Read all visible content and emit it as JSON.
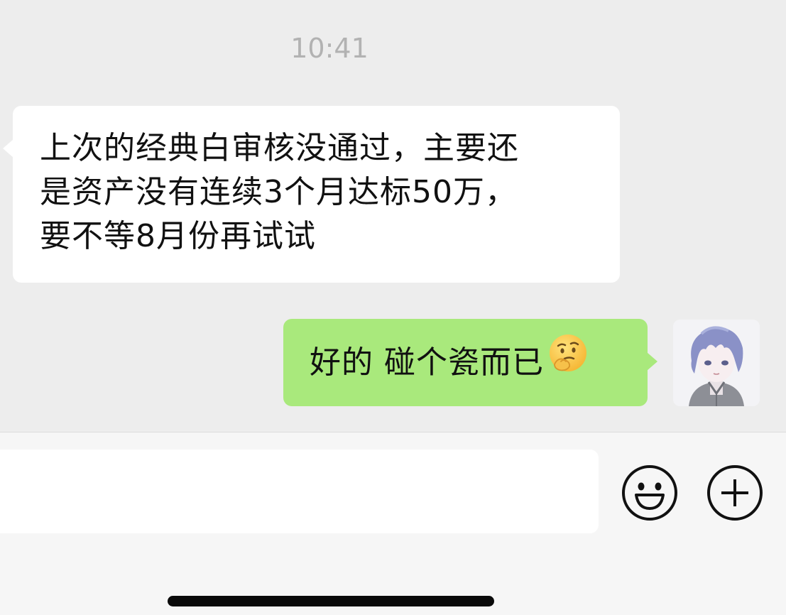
{
  "chat": {
    "timestamp": "10:41",
    "incoming_message": {
      "lines": [
        "上次的经典白审核没通过，主要还",
        "是资产没有连续3个月达标50万，",
        "要不等8月份再试试"
      ]
    },
    "outgoing_message": {
      "text": "好的 碰个瓷而已",
      "emoji": "thinking-face-emoji"
    },
    "colors": {
      "background": "#ededed",
      "incoming_bubble": "#ffffff",
      "outgoing_bubble": "#a9e97c",
      "timestamp": "#b2b2b2"
    }
  },
  "input_bar": {
    "text_value": "",
    "emoji_button_icon": "smiley-face-icon",
    "plus_button_icon": "plus-circle-icon"
  }
}
